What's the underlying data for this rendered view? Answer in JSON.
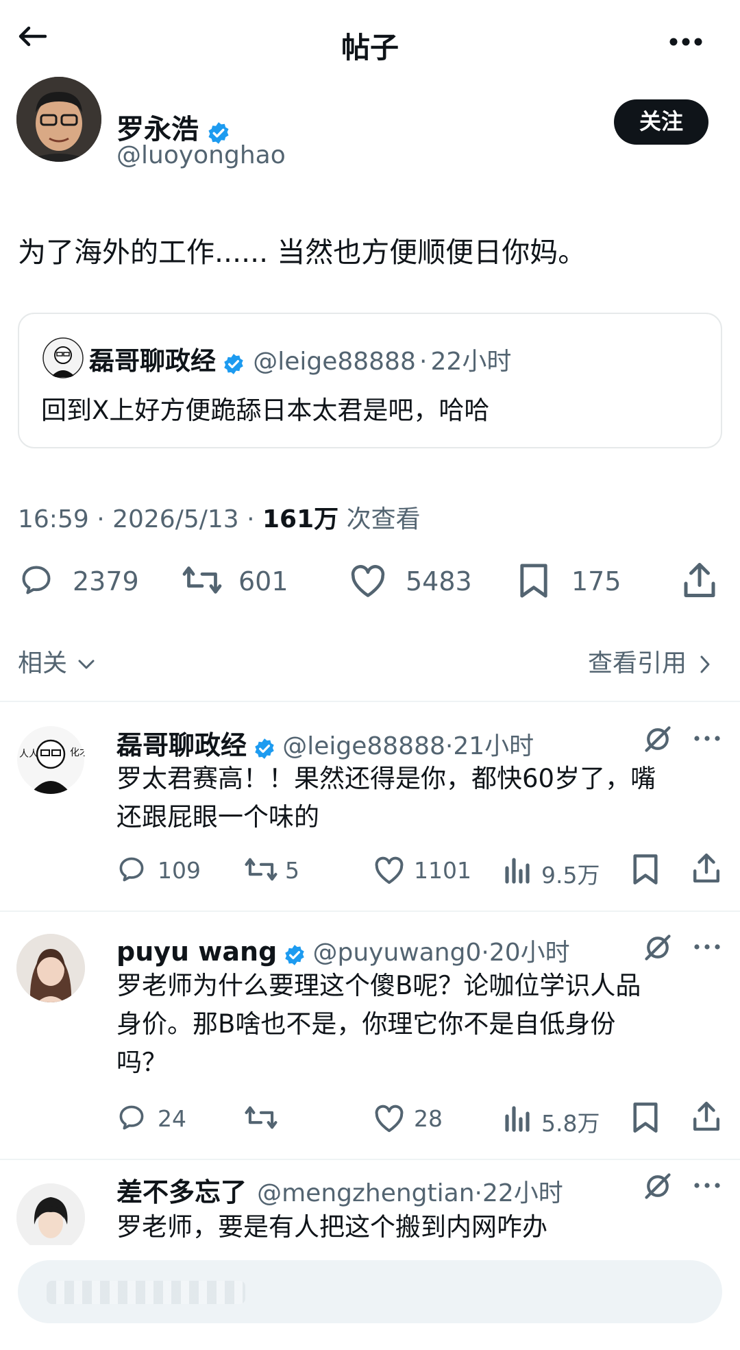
{
  "header": {
    "title": "帖子"
  },
  "post": {
    "author_name": "罗永浩",
    "author_handle": "@luoyonghao",
    "follow_label": "关注",
    "text": "为了海外的工作...... 当然也方便顺便日你妈。",
    "quote": {
      "author_name": "磊哥聊政经",
      "author_handle": "@leige88888",
      "dot": "·",
      "time": "22小时",
      "text": "回到X上好方便跪舔日本太君是吧，哈哈"
    },
    "meta_time": "16:59 · 2026/5/13 · ",
    "views_count": "161万",
    "views_label": " 次查看",
    "stats": {
      "replies": "2379",
      "reposts": "601",
      "likes": "5483",
      "bookmarks": "175"
    }
  },
  "related": {
    "label": "相关",
    "view_quotes": "查看引用"
  },
  "replies": [
    {
      "name": "磊哥聊政经",
      "handle": "@leige88888",
      "dot": "·",
      "time": "21小时",
      "text_lines": [
        "罗太君赛高！！果然还得是你，都快60岁了，嘴",
        "还跟屁眼一个味的"
      ],
      "stats": {
        "replies": "109",
        "reposts": "5",
        "likes": "1101",
        "views": "9.5万"
      }
    },
    {
      "name": "puyu wang",
      "handle": "@puyuwang0",
      "dot": "·",
      "time": "20小时",
      "text_lines": [
        "罗老师为什么要理这个傻B呢？论咖位学识人品",
        "身价。那B啥也不是，你理它你不是自低身份",
        "吗？"
      ],
      "stats": {
        "replies": "24",
        "reposts": "",
        "likes": "28",
        "views": "5.8万"
      }
    },
    {
      "name": "差不多忘了",
      "handle": "@mengzhengtian",
      "dot": "·",
      "time": "22小时",
      "text_lines": [
        "罗老师，要是有人把这个搬到内网咋办"
      ],
      "stats": {
        "replies": "",
        "reposts": "",
        "likes": "",
        "views": ""
      }
    }
  ],
  "colors": {
    "verified": "#1d9bf0",
    "text": "#0f1419",
    "muted": "#536471",
    "border": "#eff3f4"
  }
}
